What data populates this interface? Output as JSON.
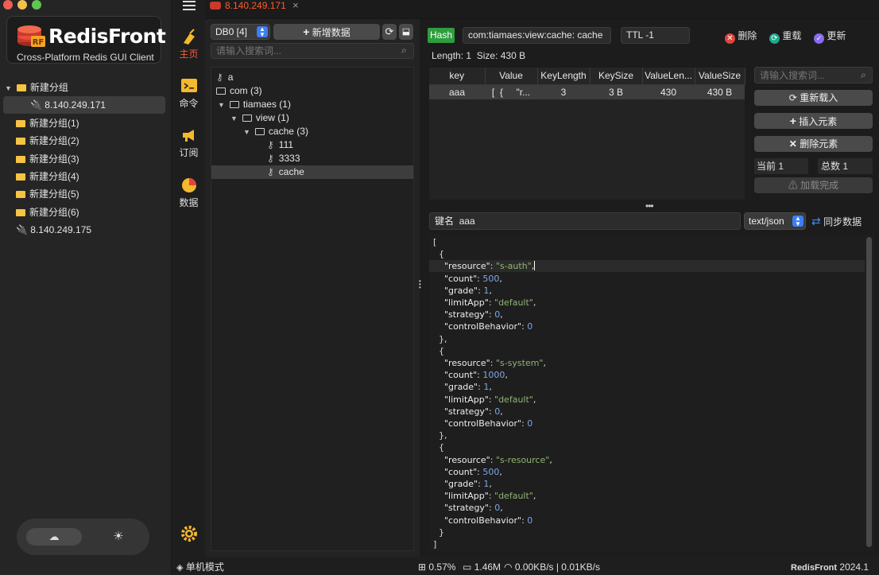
{
  "window": {
    "tab_title": "8.140.249.171",
    "close_glyph": "×"
  },
  "traffic_lights": {
    "close": "#ec5f57",
    "minimize": "#f4bf4f",
    "maximize": "#61c554"
  },
  "logo": {
    "title": "RedisFront",
    "subtitle": "Cross-Platform Redis GUI Client",
    "badge": "RF"
  },
  "connections": [
    {
      "label": "新建分组",
      "type": "group-open"
    },
    {
      "label": "8.140.249.171",
      "type": "server-selected"
    },
    {
      "label": "新建分组(1)",
      "type": "group"
    },
    {
      "label": "新建分组(2)",
      "type": "group"
    },
    {
      "label": "新建分组(3)",
      "type": "group"
    },
    {
      "label": "新建分组(4)",
      "type": "group"
    },
    {
      "label": "新建分组(5)",
      "type": "group"
    },
    {
      "label": "新建分组(6)",
      "type": "group"
    },
    {
      "label": "8.140.249.175",
      "type": "server"
    }
  ],
  "nav": {
    "home": "主页",
    "command": "命令",
    "subscribe": "订阅",
    "data": "数据"
  },
  "db": {
    "selected": "DB0 [4]",
    "add_button": "新增数据",
    "search_placeholder": "请输入搜索词..."
  },
  "key_tree": [
    {
      "label": "a",
      "kind": "key"
    },
    {
      "label": "com (3)",
      "kind": "folder-collapsed"
    },
    {
      "label": "tiamaes (1)",
      "kind": "folder-open"
    },
    {
      "label": "view (1)",
      "kind": "folder-open"
    },
    {
      "label": "cache (3)",
      "kind": "folder-open"
    },
    {
      "label": "111",
      "kind": "key"
    },
    {
      "label": "3333",
      "kind": "key"
    },
    {
      "label": "cache",
      "kind": "key-selected"
    }
  ],
  "detail": {
    "type_badge": "Hash",
    "key_name": "com:tiamaes:view:cache: cache",
    "ttl": "TTL -1",
    "delete_label": "删除",
    "reload_label": "重载",
    "update_label": "更新",
    "length": "Length: 1",
    "size": "Size: 430 B"
  },
  "table": {
    "headers": [
      "key",
      "Value",
      "KeyLength",
      "KeySize",
      "ValueLen...",
      "ValueSize"
    ],
    "rows": [
      [
        "aaa",
        "[  {     \"r...",
        "3",
        "3 B",
        "430",
        "430 B"
      ]
    ]
  },
  "side_panel": {
    "search_placeholder": "请输入搜索词...",
    "reload": "重新载入",
    "insert": "插入元素",
    "delete": "删除元素",
    "current_label": "当前",
    "current_value": "1",
    "total_label": "总数",
    "total_value": "1",
    "load_complete": "加载完成"
  },
  "editor": {
    "key_label": "键名",
    "key_value": "aaa",
    "format": "text/json",
    "sync_label": "同步数据",
    "json_lines": [
      [
        {
          "t": "["
        }
      ],
      [
        {
          "t": "  {"
        }
      ],
      [
        {
          "t": "    "
        },
        {
          "t": "\"resource\"",
          "c": "key"
        },
        {
          "t": ": "
        },
        {
          "t": "\"s-auth\"",
          "c": "str"
        },
        {
          "t": ","
        }
      ],
      [
        {
          "t": "    "
        },
        {
          "t": "\"count\"",
          "c": "key"
        },
        {
          "t": ": "
        },
        {
          "t": "500",
          "c": "num"
        },
        {
          "t": ","
        }
      ],
      [
        {
          "t": "    "
        },
        {
          "t": "\"grade\"",
          "c": "key"
        },
        {
          "t": ": "
        },
        {
          "t": "1",
          "c": "num"
        },
        {
          "t": ","
        }
      ],
      [
        {
          "t": "    "
        },
        {
          "t": "\"limitApp\"",
          "c": "key"
        },
        {
          "t": ": "
        },
        {
          "t": "\"default\"",
          "c": "str"
        },
        {
          "t": ","
        }
      ],
      [
        {
          "t": "    "
        },
        {
          "t": "\"strategy\"",
          "c": "key"
        },
        {
          "t": ": "
        },
        {
          "t": "0",
          "c": "num"
        },
        {
          "t": ","
        }
      ],
      [
        {
          "t": "    "
        },
        {
          "t": "\"controlBehavior\"",
          "c": "key"
        },
        {
          "t": ": "
        },
        {
          "t": "0",
          "c": "num"
        }
      ],
      [
        {
          "t": "  },"
        }
      ],
      [
        {
          "t": "  {"
        }
      ],
      [
        {
          "t": "    "
        },
        {
          "t": "\"resource\"",
          "c": "key"
        },
        {
          "t": ": "
        },
        {
          "t": "\"s-system\"",
          "c": "str"
        },
        {
          "t": ","
        }
      ],
      [
        {
          "t": "    "
        },
        {
          "t": "\"count\"",
          "c": "key"
        },
        {
          "t": ": "
        },
        {
          "t": "1000",
          "c": "num"
        },
        {
          "t": ","
        }
      ],
      [
        {
          "t": "    "
        },
        {
          "t": "\"grade\"",
          "c": "key"
        },
        {
          "t": ": "
        },
        {
          "t": "1",
          "c": "num"
        },
        {
          "t": ","
        }
      ],
      [
        {
          "t": "    "
        },
        {
          "t": "\"limitApp\"",
          "c": "key"
        },
        {
          "t": ": "
        },
        {
          "t": "\"default\"",
          "c": "str"
        },
        {
          "t": ","
        }
      ],
      [
        {
          "t": "    "
        },
        {
          "t": "\"strategy\"",
          "c": "key"
        },
        {
          "t": ": "
        },
        {
          "t": "0",
          "c": "num"
        },
        {
          "t": ","
        }
      ],
      [
        {
          "t": "    "
        },
        {
          "t": "\"controlBehavior\"",
          "c": "key"
        },
        {
          "t": ": "
        },
        {
          "t": "0",
          "c": "num"
        }
      ],
      [
        {
          "t": "  },"
        }
      ],
      [
        {
          "t": "  {"
        }
      ],
      [
        {
          "t": "    "
        },
        {
          "t": "\"resource\"",
          "c": "key"
        },
        {
          "t": ": "
        },
        {
          "t": "\"s-resource\"",
          "c": "str"
        },
        {
          "t": ","
        }
      ],
      [
        {
          "t": "    "
        },
        {
          "t": "\"count\"",
          "c": "key"
        },
        {
          "t": ": "
        },
        {
          "t": "500",
          "c": "num"
        },
        {
          "t": ","
        }
      ],
      [
        {
          "t": "    "
        },
        {
          "t": "\"grade\"",
          "c": "key"
        },
        {
          "t": ": "
        },
        {
          "t": "1",
          "c": "num"
        },
        {
          "t": ","
        }
      ],
      [
        {
          "t": "    "
        },
        {
          "t": "\"limitApp\"",
          "c": "key"
        },
        {
          "t": ": "
        },
        {
          "t": "\"default\"",
          "c": "str"
        },
        {
          "t": ","
        }
      ],
      [
        {
          "t": "    "
        },
        {
          "t": "\"strategy\"",
          "c": "key"
        },
        {
          "t": ": "
        },
        {
          "t": "0",
          "c": "num"
        },
        {
          "t": ","
        }
      ],
      [
        {
          "t": "    "
        },
        {
          "t": "\"controlBehavior\"",
          "c": "key"
        },
        {
          "t": ": "
        },
        {
          "t": "0",
          "c": "num"
        }
      ],
      [
        {
          "t": "  }"
        }
      ],
      [
        {
          "t": "]"
        }
      ]
    ]
  },
  "status": {
    "mode": "单机模式",
    "cpu": "0.57%",
    "memory": "1.46M",
    "network": "0.00KB/s | 0.01KB/s",
    "brand": "RedisFront",
    "version": "2024.1"
  },
  "colors": {
    "accent_green": "#2e9e3e",
    "delete_red": "#e0443e",
    "reload_teal": "#1fa88e",
    "update_purple": "#8a6cf0",
    "selection": "#3d3d3d"
  }
}
